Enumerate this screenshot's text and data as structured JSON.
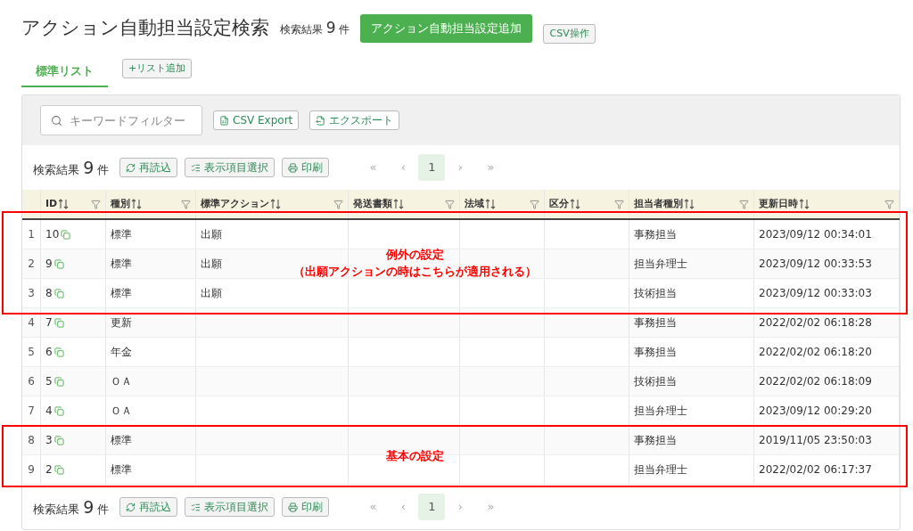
{
  "header": {
    "title": "アクション自動担当設定検索",
    "result_label": "検索結果",
    "result_count": "9",
    "result_unit": "件",
    "add_button": "アクション自動担当設定追加",
    "csv_button": "CSV操作"
  },
  "tabs": [
    {
      "label": "標準リスト",
      "selected": true
    }
  ],
  "add_list_button": "+リスト追加",
  "filter": {
    "placeholder": "キーワードフィルター"
  },
  "export_buttons": [
    {
      "label": "CSV Export",
      "kind": "csv"
    },
    {
      "label": "エクスポート",
      "kind": "export"
    }
  ],
  "toolbars": [
    {
      "result_label": "検索結果",
      "count": "9",
      "unit": "件",
      "buttons": [
        {
          "label": "再読込",
          "kind": "reload"
        },
        {
          "label": "表示項目選択",
          "kind": "columns"
        },
        {
          "label": "印刷",
          "kind": "print"
        }
      ],
      "pager": {
        "first": "«",
        "prev": "‹",
        "pages": [
          {
            "label": "1",
            "selected": true
          }
        ],
        "next": "›",
        "last": "»"
      }
    },
    {
      "result_label": "検索結果",
      "count": "9",
      "unit": "件",
      "buttons": [
        {
          "label": "再読込",
          "kind": "reload"
        },
        {
          "label": "表示項目選択",
          "kind": "columns"
        },
        {
          "label": "印刷",
          "kind": "print"
        }
      ],
      "pager": {
        "first": "«",
        "prev": "‹",
        "pages": [
          {
            "label": "1",
            "selected": true
          }
        ],
        "next": "›",
        "last": "»"
      }
    }
  ],
  "table": {
    "columns": [
      "ID",
      "種別",
      "標準アクション",
      "発送書類",
      "法域",
      "区分",
      "担当者種別",
      "更新日時"
    ],
    "rows": [
      {
        "n": "1",
        "id": "10",
        "type": "標準",
        "action": "出願",
        "assignee": "事務担当",
        "updated": "2023/09/12 00:34:01"
      },
      {
        "n": "2",
        "id": "9",
        "type": "標準",
        "action": "出願",
        "assignee": "担当弁理士",
        "updated": "2023/09/12 00:33:53"
      },
      {
        "n": "3",
        "id": "8",
        "type": "標準",
        "action": "出願",
        "assignee": "技術担当",
        "updated": "2023/09/12 00:33:03"
      },
      {
        "n": "4",
        "id": "7",
        "type": "更新",
        "action": "",
        "assignee": "事務担当",
        "updated": "2022/02/02 06:18:28"
      },
      {
        "n": "5",
        "id": "6",
        "type": "年金",
        "action": "",
        "assignee": "事務担当",
        "updated": "2022/02/02 06:18:20"
      },
      {
        "n": "6",
        "id": "5",
        "type": "ＯＡ",
        "action": "",
        "assignee": "技術担当",
        "updated": "2022/02/02 06:18:09"
      },
      {
        "n": "7",
        "id": "4",
        "type": "ＯＡ",
        "action": "",
        "assignee": "担当弁理士",
        "updated": "2023/09/12 00:29:20"
      },
      {
        "n": "8",
        "id": "3",
        "type": "標準",
        "action": "",
        "assignee": "事務担当",
        "updated": "2019/11/05 23:50:03"
      },
      {
        "n": "9",
        "id": "2",
        "type": "標準",
        "action": "",
        "assignee": "担当弁理士",
        "updated": "2022/02/02 06:17:37"
      }
    ]
  },
  "annotations": [
    {
      "lines": [
        "例外の設定",
        "（出願アクションの時はこちらが適用される）"
      ]
    },
    {
      "lines": [
        "基本の設定"
      ]
    }
  ]
}
